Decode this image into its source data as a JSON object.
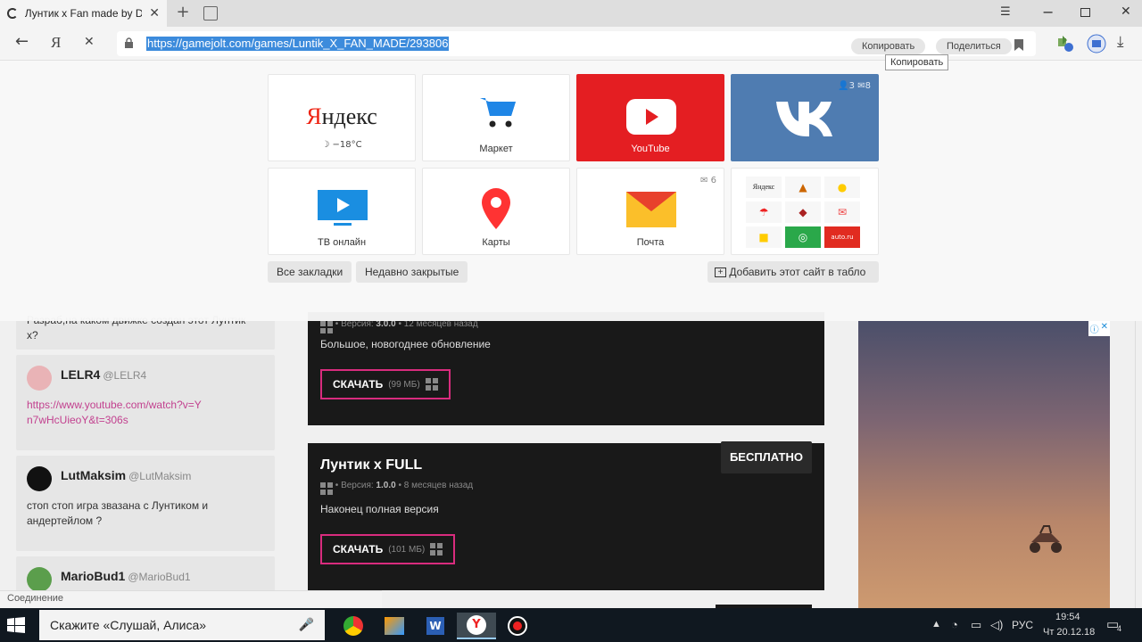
{
  "browser": {
    "tab_title": "Лунтик x Fan made by D",
    "url": "https://gamejolt.com/games/Luntik_X_FAN_MADE/293806",
    "copy_label": "Копировать",
    "share_label": "Поделиться",
    "tooltip": "Копировать",
    "back_glyph": "←",
    "yandex_glyph": "Я",
    "stop_glyph": "✕"
  },
  "ntp": {
    "tiles": [
      {
        "label": "",
        "logo": "Яндекс",
        "weather": "−18°C"
      },
      {
        "label": "Маркет"
      },
      {
        "label": "YouTube"
      },
      {
        "label": "",
        "friends": "3",
        "messages": "8"
      },
      {
        "label": "ТВ онлайн"
      },
      {
        "label": "Карты"
      },
      {
        "label": "Почта",
        "count": "6"
      },
      {
        "label": "",
        "mini_yandex": "Яндекс",
        "mini_auto": "auto.ru"
      }
    ],
    "all_bookmarks": "Все закладки",
    "recently_closed": "Недавно закрытые",
    "add_site": "Добавить этот сайт в табло"
  },
  "comments": [
    {
      "text": "Разраб,на каком движке создан этот Лунтик х?"
    },
    {
      "author": "LELR4",
      "handle": "@LELR4",
      "text": "https://www.youtube.com/watch?v=Yn7wHcUieoY&t=306s"
    },
    {
      "author": "LutMaksim",
      "handle": "@LutMaksim",
      "text": "стоп стоп игра звазана с Лунтиком и андертейлом ?"
    },
    {
      "author": "MarioBud1",
      "handle": "@MarioBud1"
    }
  ],
  "releases": [
    {
      "meta_version_label": "Версия:",
      "version": "3.0.0",
      "when": "12 месяцев назад",
      "desc": "Большое, новогоднее обновление",
      "download": "СКАЧАТЬ",
      "size": "(99 МБ)"
    },
    {
      "title": "Лунтик x FULL",
      "free": "БЕСПЛАТНО",
      "meta_version_label": "Версия:",
      "version": "1.0.0",
      "when": "8 месяцев назад",
      "desc": "Наконец полная версия",
      "download": "СКАЧАТЬ",
      "size": "(101 МБ)"
    }
  ],
  "status": "Соединение",
  "taskbar": {
    "search": "Скажите «Слушай, Алиса»",
    "lang": "РУС",
    "time": "19:54",
    "date": "Чт 20.12.18",
    "notif_count": "4"
  }
}
